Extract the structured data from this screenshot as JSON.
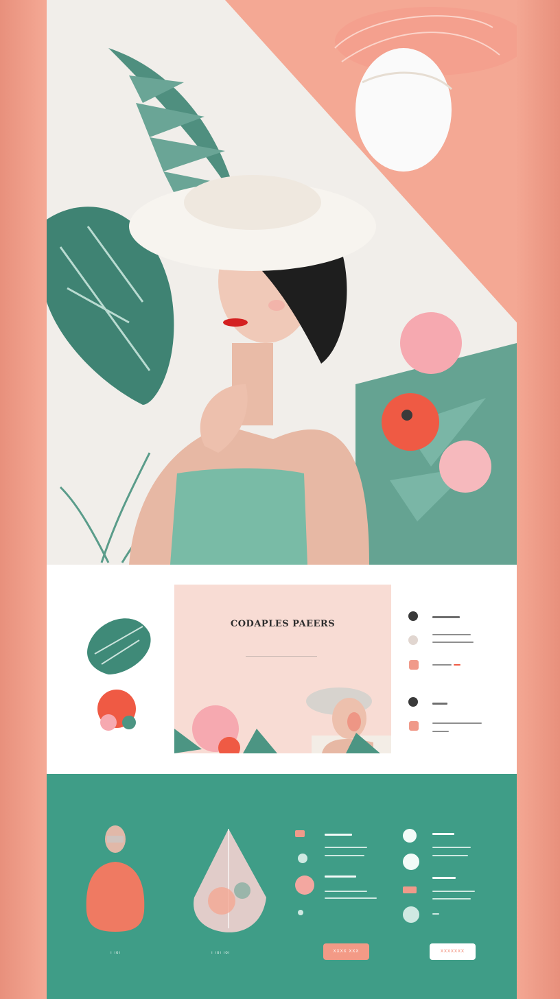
{
  "colors": {
    "coral": "#f2a08c",
    "mint": "#3f9d87",
    "cream": "#f1eeea",
    "pink": "#f8dcd4"
  },
  "hero": {
    "image": "woman-in-white-hat-tropical-leaves"
  },
  "feature": {
    "title": "CODAPLES PAEERS"
  },
  "right_list": {
    "items": [
      {
        "label": "XXXX XXXX"
      },
      {
        "label": "XXX XXXX XXXX"
      },
      {
        "label": "XXXX XXX"
      },
      {
        "label": "XXXXX"
      }
    ]
  },
  "bottom": {
    "product1_caption": "ı ıoı",
    "product2_caption": "ı ıoı ıoı",
    "button_primary": "XXXX XXX",
    "button_secondary": "XXXXXXX",
    "list_left": [
      {
        "label": "XXXX XXXX"
      },
      {
        "label": "XXXXX XXXXX"
      }
    ],
    "list_right": [
      {
        "label": "XXXXX"
      },
      {
        "label": "XXXX XXXX"
      }
    ]
  }
}
